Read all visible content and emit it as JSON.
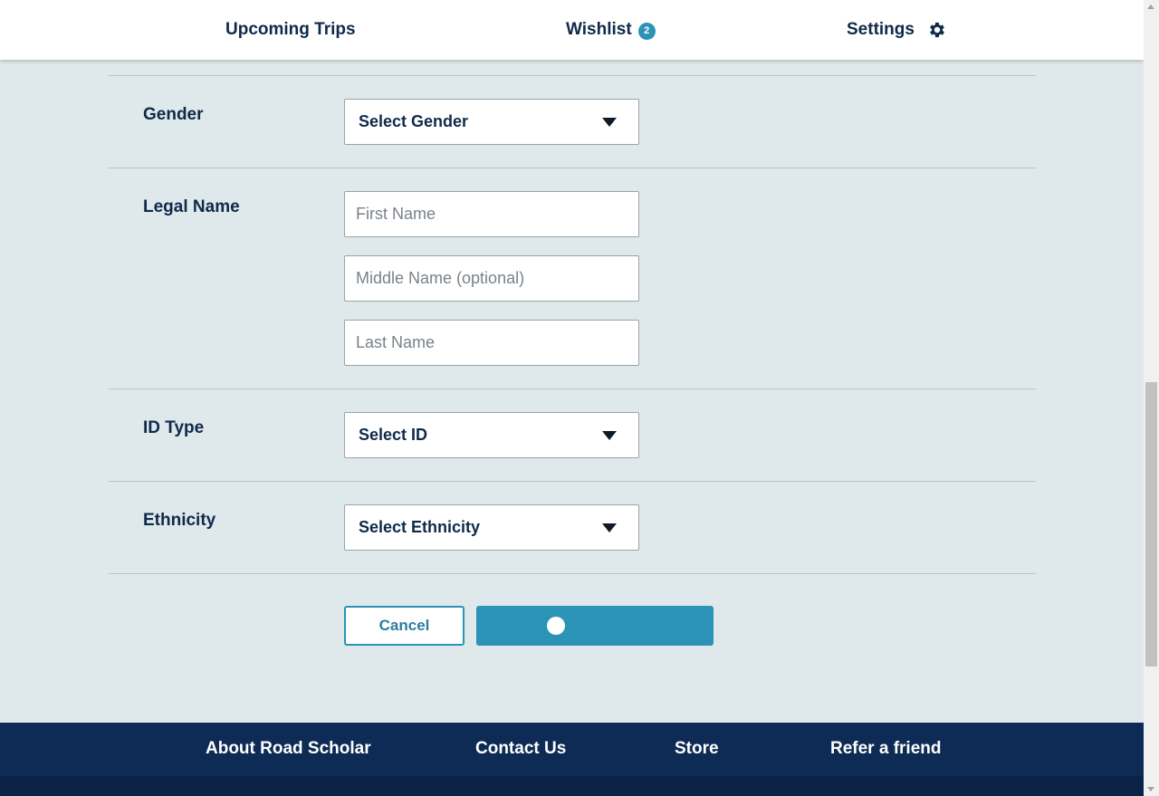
{
  "nav": {
    "upcoming_trips": "Upcoming Trips",
    "wishlist": "Wishlist",
    "wishlist_count": "2",
    "settings": "Settings",
    "settings_icon": "gear-icon"
  },
  "form": {
    "gender": {
      "label": "Gender",
      "select_value": "Select Gender"
    },
    "legal_name": {
      "label": "Legal Name",
      "first_placeholder": "First Name",
      "middle_placeholder": "Middle Name (optional)",
      "last_placeholder": "Last Name"
    },
    "id_type": {
      "label": "ID Type",
      "select_value": "Select ID"
    },
    "ethnicity": {
      "label": "Ethnicity",
      "select_value": "Select Ethnicity"
    },
    "cancel_label": "Cancel",
    "save_state": "loading"
  },
  "footer": {
    "links": [
      "About Road Scholar",
      "Contact Us",
      "Store",
      "Refer a friend"
    ]
  },
  "colors": {
    "accent": "#2b93b5",
    "navy": "#0d2b54",
    "page_bg": "#dfe8ea"
  }
}
